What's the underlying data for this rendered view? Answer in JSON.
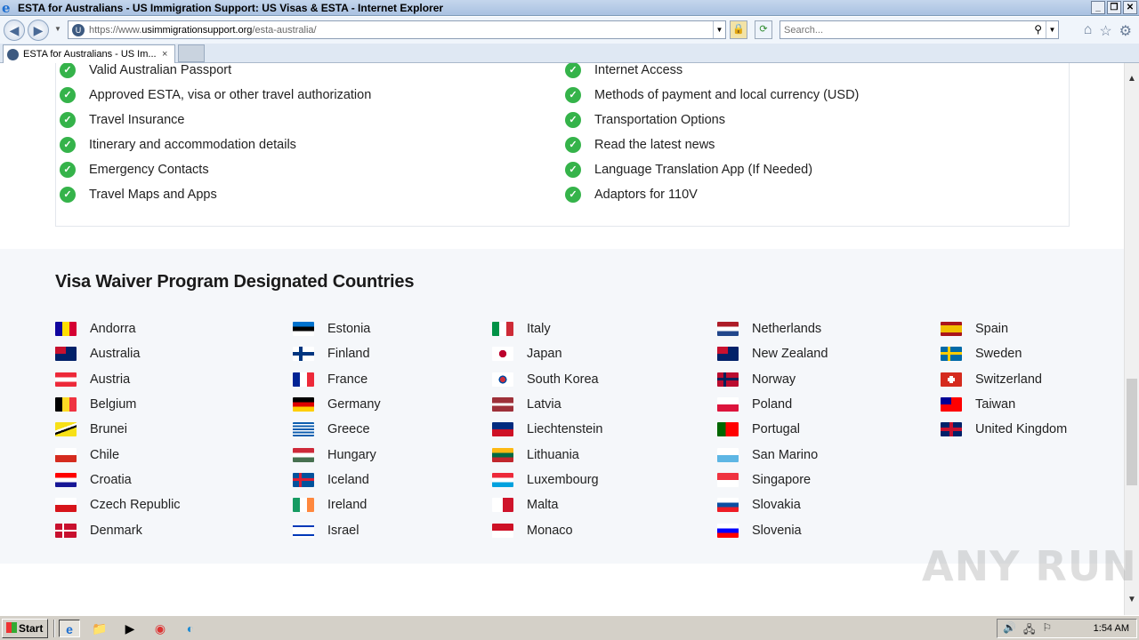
{
  "window": {
    "title": "ESTA for Australians - US Immigration Support: US Visas & ESTA - Internet Explorer"
  },
  "address_bar": {
    "url_prefix": "https://www.",
    "url_domain": "usimmigrationsupport.org",
    "url_path": "/esta-australia/"
  },
  "search": {
    "placeholder": "Search..."
  },
  "tab": {
    "label": "ESTA for Australians - US Im...",
    "close": "×"
  },
  "checklist": {
    "left": [
      "Valid Australian Passport",
      "Approved ESTA, visa or other travel authorization",
      "Travel Insurance",
      "Itinerary and accommodation details",
      "Emergency Contacts",
      "Travel Maps and Apps"
    ],
    "right": [
      "Internet Access",
      "Methods of payment and local currency (USD)",
      "Transportation Options",
      "Read the latest news",
      "Language Translation App (If Needed)",
      "Adaptors for 110V"
    ]
  },
  "vwp": {
    "title": "Visa Waiver Program Designated Countries",
    "columns": [
      [
        "Andorra",
        "Australia",
        "Austria",
        "Belgium",
        "Brunei",
        "Chile",
        "Croatia",
        "Czech Republic",
        "Denmark"
      ],
      [
        "Estonia",
        "Finland",
        "France",
        "Germany",
        "Greece",
        "Hungary",
        "Iceland",
        "Ireland",
        "Israel"
      ],
      [
        "Italy",
        "Japan",
        "South Korea",
        "Latvia",
        "Liechtenstein",
        "Lithuania",
        "Luxembourg",
        "Malta",
        "Monaco"
      ],
      [
        "Netherlands",
        "New Zealand",
        "Norway",
        "Poland",
        "Portugal",
        "San Marino",
        "Singapore",
        "Slovakia",
        "Slovenia"
      ],
      [
        "Spain",
        "Sweden",
        "Switzerland",
        "Taiwan",
        "United Kingdom"
      ]
    ]
  },
  "watermark": "ANY RUN",
  "taskbar": {
    "start_label": "Start",
    "clock": "1:54 AM"
  }
}
